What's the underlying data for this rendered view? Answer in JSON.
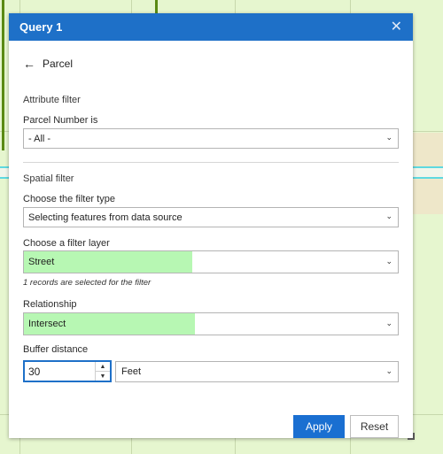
{
  "panel": {
    "title": "Query 1",
    "close_icon": "close-icon",
    "back_label": "Parcel",
    "back_icon": "arrow-left-icon"
  },
  "attribute_filter": {
    "section_label": "Attribute filter",
    "field_label": "Parcel Number is",
    "field_value": "- All -"
  },
  "spatial_filter": {
    "section_label": "Spatial filter",
    "filter_type_label": "Choose the filter type",
    "filter_type_value": "Selecting features from data source",
    "filter_layer_label": "Choose a filter layer",
    "filter_layer_value": "Street",
    "selection_note": "1 records are selected for the filter",
    "relationship_label": "Relationship",
    "relationship_value": "Intersect",
    "buffer_label": "Buffer distance",
    "buffer_value": "30",
    "buffer_unit": "Feet"
  },
  "actions": {
    "apply_label": "Apply",
    "reset_label": "Reset"
  },
  "colors": {
    "header_blue": "#1e70c8",
    "highlight_green": "#b7f7b3",
    "map_green": "#e6f6cf"
  }
}
